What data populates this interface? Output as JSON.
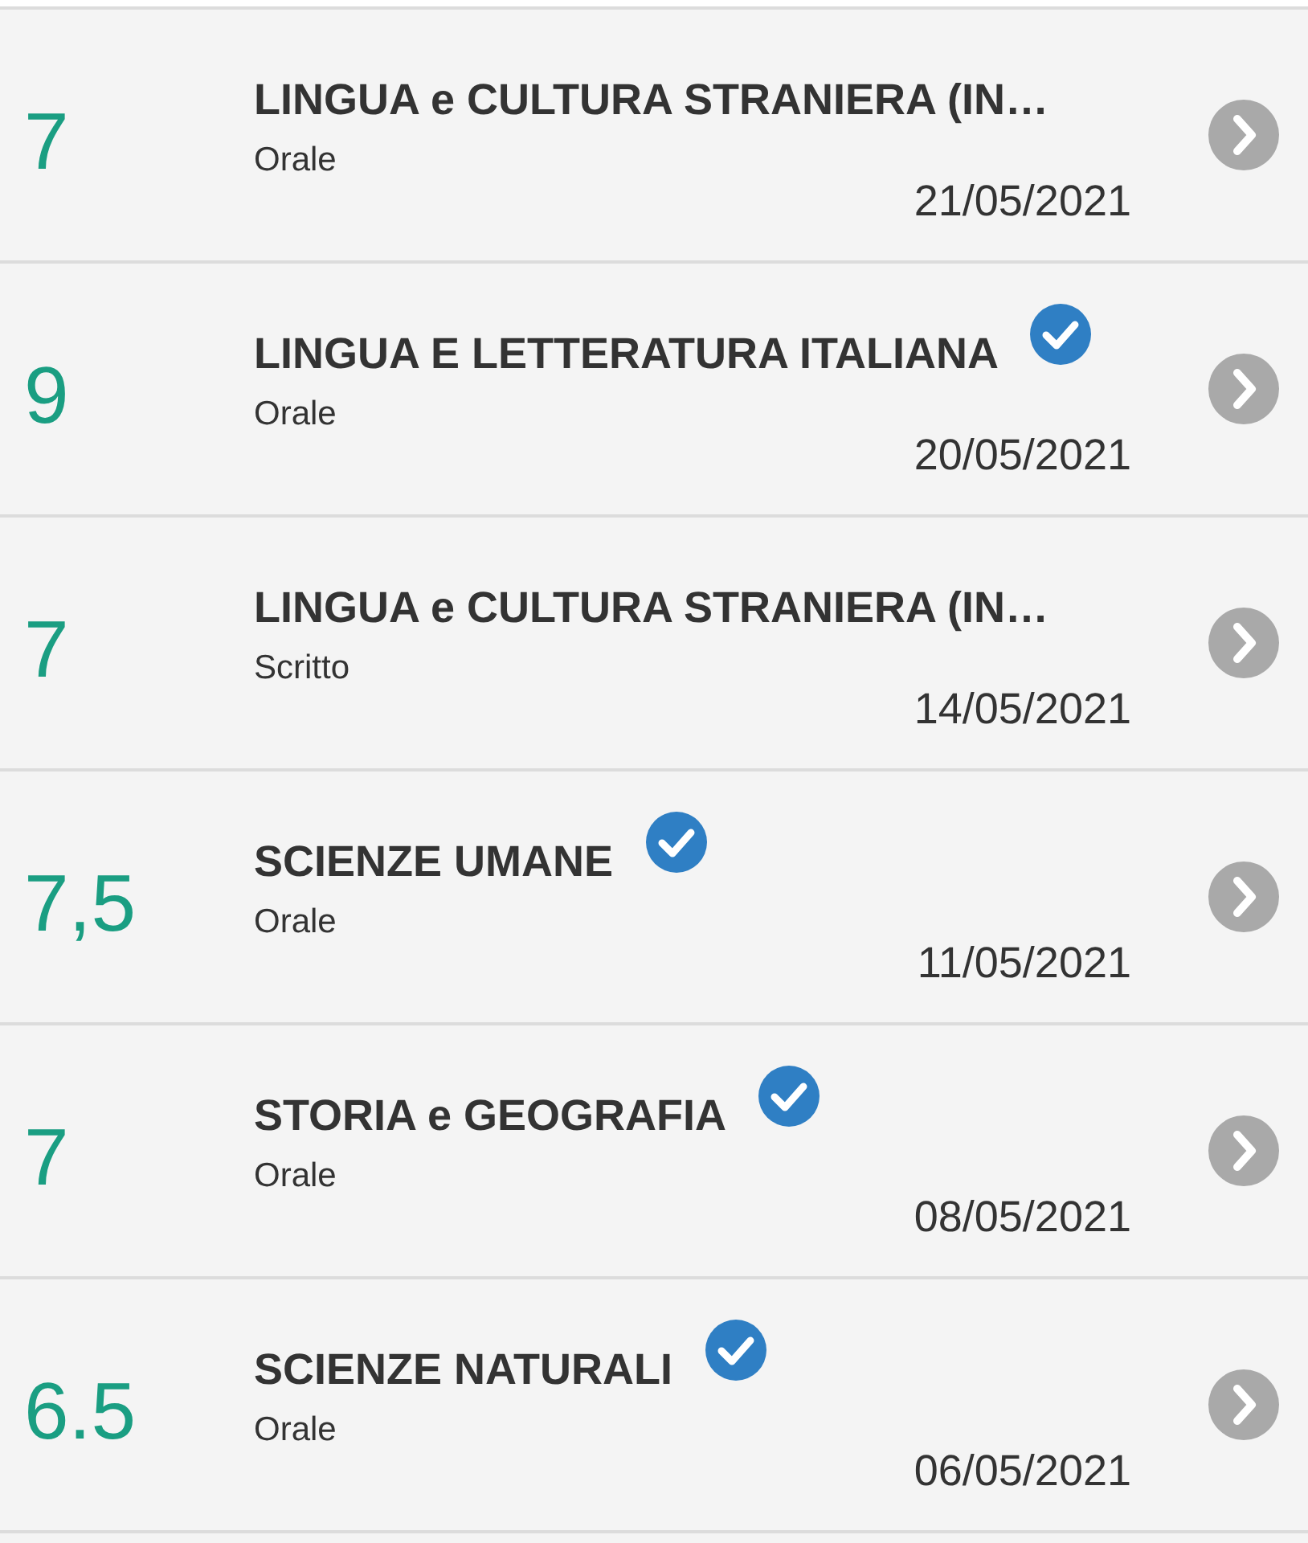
{
  "grades": [
    {
      "grade": "7",
      "subject": "LINGUA e CULTURA STRANIERA (IN…",
      "type": "Orale",
      "date": "21/05/2021",
      "verified": false
    },
    {
      "grade": "9",
      "subject": "LINGUA E LETTERATURA ITALIANA",
      "type": "Orale",
      "date": "20/05/2021",
      "verified": true
    },
    {
      "grade": "7",
      "subject": "LINGUA e CULTURA STRANIERA (IN…",
      "type": "Scritto",
      "date": "14/05/2021",
      "verified": false
    },
    {
      "grade": "7,5",
      "subject": "SCIENZE UMANE",
      "type": "Orale",
      "date": "11/05/2021",
      "verified": true
    },
    {
      "grade": "7",
      "subject": "STORIA e GEOGRAFIA",
      "type": "Orale",
      "date": "08/05/2021",
      "verified": true
    },
    {
      "grade": "6.5",
      "subject": "SCIENZE NATURALI",
      "type": "Orale",
      "date": "06/05/2021",
      "verified": true
    }
  ]
}
